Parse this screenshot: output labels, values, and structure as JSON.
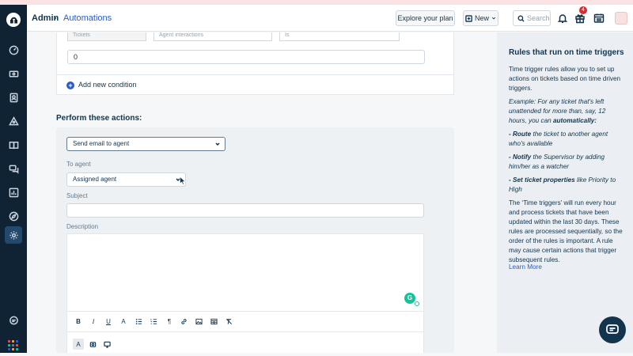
{
  "header": {
    "admin_label": "Admin",
    "separator": "›",
    "page_label": "Automations",
    "explore_plan_label": "Explore your plan",
    "new_label": "New",
    "search_placeholder": "Search",
    "notification_count": "4"
  },
  "condition": {
    "field_1": "Tickets",
    "field_2": "Agent interactions",
    "field_3": "Is",
    "value": "0",
    "add_condition_label": "Add new condition"
  },
  "actions": {
    "section_title": "Perform these actions:",
    "action_select": "Send email to agent",
    "to_agent_label": "To agent",
    "to_agent_value": "Assigned agent",
    "subject_label": "Subject",
    "subject_value": "",
    "description_label": "Description",
    "description_value": "",
    "grammarly_letter": "G",
    "toolbar": {
      "bold": "B",
      "italic": "I",
      "underline": "U",
      "font_size": "A",
      "paragraph": "¶"
    },
    "secondary_toolbar": {
      "text_format": "A"
    }
  },
  "sidebar": {
    "title": "Rules that run on time triggers",
    "intro": "Time trigger rules allow you to set up actions on tickets based on time driven triggers.",
    "example_prefix": "Example: For any ticket that's left unattended for more than, say, 12 hours, you can ",
    "example_bold": "automatically:",
    "item_route_bold": "- Route",
    "item_route_rest": " the ticket to another agent who's available",
    "item_notify_bold": "- Notify",
    "item_notify_rest": " the Supervisor by adding him/her as a watcher",
    "item_set_bold": "- Set ticket properties",
    "item_set_rest": " like Priority to High",
    "body": "The ‘Time triggers’ will run every hour and process tickets that have been updated within the last 30 days. These rules are processed sequentially, so the order of the rules is important. A rule may cause certain actions that trigger subsequent rules.",
    "learn_more": "Learn More"
  },
  "colors": {
    "nav_bg": "#0f2335",
    "accent": "#2c5cc5",
    "badge": "#d72d30",
    "grammarly": "#15c39a"
  },
  "icons": {
    "nav": [
      "logo-icon",
      "dashboard-icon",
      "tickets-icon",
      "contacts-icon",
      "groups-icon",
      "solutions-icon",
      "forums-icon",
      "reports-icon",
      "discover-icon",
      "admin-gear-icon",
      "chat-icon",
      "apps-grid-icon"
    ],
    "header": [
      "plus-square-icon",
      "search-icon",
      "bell-icon",
      "gift-icon",
      "calendar-icon"
    ]
  }
}
